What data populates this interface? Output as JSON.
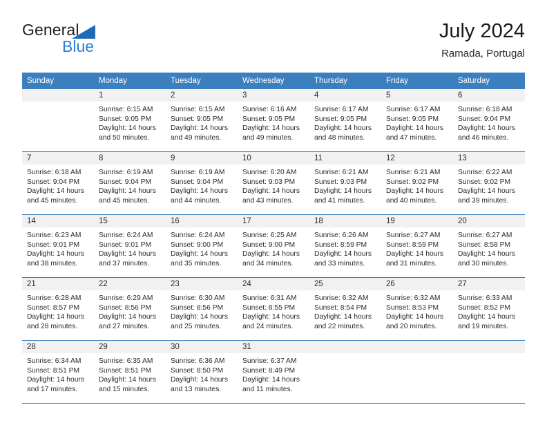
{
  "brand": {
    "name_part1": "General",
    "name_part2": "Blue",
    "accent_color": "#2a7fd4",
    "triangle_color": "#1b6cb5"
  },
  "header": {
    "month_title": "July 2024",
    "location": "Ramada, Portugal"
  },
  "calendar": {
    "header_bg": "#3c7fbf",
    "daynum_bg": "#f1f1f1",
    "weekdays": [
      "Sunday",
      "Monday",
      "Tuesday",
      "Wednesday",
      "Thursday",
      "Friday",
      "Saturday"
    ],
    "weeks": [
      [
        {
          "day": "",
          "sunrise": "",
          "sunset": "",
          "daylight_1": "",
          "daylight_2": ""
        },
        {
          "day": "1",
          "sunrise": "Sunrise: 6:15 AM",
          "sunset": "Sunset: 9:05 PM",
          "daylight_1": "Daylight: 14 hours",
          "daylight_2": "and 50 minutes."
        },
        {
          "day": "2",
          "sunrise": "Sunrise: 6:15 AM",
          "sunset": "Sunset: 9:05 PM",
          "daylight_1": "Daylight: 14 hours",
          "daylight_2": "and 49 minutes."
        },
        {
          "day": "3",
          "sunrise": "Sunrise: 6:16 AM",
          "sunset": "Sunset: 9:05 PM",
          "daylight_1": "Daylight: 14 hours",
          "daylight_2": "and 49 minutes."
        },
        {
          "day": "4",
          "sunrise": "Sunrise: 6:17 AM",
          "sunset": "Sunset: 9:05 PM",
          "daylight_1": "Daylight: 14 hours",
          "daylight_2": "and 48 minutes."
        },
        {
          "day": "5",
          "sunrise": "Sunrise: 6:17 AM",
          "sunset": "Sunset: 9:05 PM",
          "daylight_1": "Daylight: 14 hours",
          "daylight_2": "and 47 minutes."
        },
        {
          "day": "6",
          "sunrise": "Sunrise: 6:18 AM",
          "sunset": "Sunset: 9:04 PM",
          "daylight_1": "Daylight: 14 hours",
          "daylight_2": "and 46 minutes."
        }
      ],
      [
        {
          "day": "7",
          "sunrise": "Sunrise: 6:18 AM",
          "sunset": "Sunset: 9:04 PM",
          "daylight_1": "Daylight: 14 hours",
          "daylight_2": "and 45 minutes."
        },
        {
          "day": "8",
          "sunrise": "Sunrise: 6:19 AM",
          "sunset": "Sunset: 9:04 PM",
          "daylight_1": "Daylight: 14 hours",
          "daylight_2": "and 45 minutes."
        },
        {
          "day": "9",
          "sunrise": "Sunrise: 6:19 AM",
          "sunset": "Sunset: 9:04 PM",
          "daylight_1": "Daylight: 14 hours",
          "daylight_2": "and 44 minutes."
        },
        {
          "day": "10",
          "sunrise": "Sunrise: 6:20 AM",
          "sunset": "Sunset: 9:03 PM",
          "daylight_1": "Daylight: 14 hours",
          "daylight_2": "and 43 minutes."
        },
        {
          "day": "11",
          "sunrise": "Sunrise: 6:21 AM",
          "sunset": "Sunset: 9:03 PM",
          "daylight_1": "Daylight: 14 hours",
          "daylight_2": "and 41 minutes."
        },
        {
          "day": "12",
          "sunrise": "Sunrise: 6:21 AM",
          "sunset": "Sunset: 9:02 PM",
          "daylight_1": "Daylight: 14 hours",
          "daylight_2": "and 40 minutes."
        },
        {
          "day": "13",
          "sunrise": "Sunrise: 6:22 AM",
          "sunset": "Sunset: 9:02 PM",
          "daylight_1": "Daylight: 14 hours",
          "daylight_2": "and 39 minutes."
        }
      ],
      [
        {
          "day": "14",
          "sunrise": "Sunrise: 6:23 AM",
          "sunset": "Sunset: 9:01 PM",
          "daylight_1": "Daylight: 14 hours",
          "daylight_2": "and 38 minutes."
        },
        {
          "day": "15",
          "sunrise": "Sunrise: 6:24 AM",
          "sunset": "Sunset: 9:01 PM",
          "daylight_1": "Daylight: 14 hours",
          "daylight_2": "and 37 minutes."
        },
        {
          "day": "16",
          "sunrise": "Sunrise: 6:24 AM",
          "sunset": "Sunset: 9:00 PM",
          "daylight_1": "Daylight: 14 hours",
          "daylight_2": "and 35 minutes."
        },
        {
          "day": "17",
          "sunrise": "Sunrise: 6:25 AM",
          "sunset": "Sunset: 9:00 PM",
          "daylight_1": "Daylight: 14 hours",
          "daylight_2": "and 34 minutes."
        },
        {
          "day": "18",
          "sunrise": "Sunrise: 6:26 AM",
          "sunset": "Sunset: 8:59 PM",
          "daylight_1": "Daylight: 14 hours",
          "daylight_2": "and 33 minutes."
        },
        {
          "day": "19",
          "sunrise": "Sunrise: 6:27 AM",
          "sunset": "Sunset: 8:59 PM",
          "daylight_1": "Daylight: 14 hours",
          "daylight_2": "and 31 minutes."
        },
        {
          "day": "20",
          "sunrise": "Sunrise: 6:27 AM",
          "sunset": "Sunset: 8:58 PM",
          "daylight_1": "Daylight: 14 hours",
          "daylight_2": "and 30 minutes."
        }
      ],
      [
        {
          "day": "21",
          "sunrise": "Sunrise: 6:28 AM",
          "sunset": "Sunset: 8:57 PM",
          "daylight_1": "Daylight: 14 hours",
          "daylight_2": "and 28 minutes."
        },
        {
          "day": "22",
          "sunrise": "Sunrise: 6:29 AM",
          "sunset": "Sunset: 8:56 PM",
          "daylight_1": "Daylight: 14 hours",
          "daylight_2": "and 27 minutes."
        },
        {
          "day": "23",
          "sunrise": "Sunrise: 6:30 AM",
          "sunset": "Sunset: 8:56 PM",
          "daylight_1": "Daylight: 14 hours",
          "daylight_2": "and 25 minutes."
        },
        {
          "day": "24",
          "sunrise": "Sunrise: 6:31 AM",
          "sunset": "Sunset: 8:55 PM",
          "daylight_1": "Daylight: 14 hours",
          "daylight_2": "and 24 minutes."
        },
        {
          "day": "25",
          "sunrise": "Sunrise: 6:32 AM",
          "sunset": "Sunset: 8:54 PM",
          "daylight_1": "Daylight: 14 hours",
          "daylight_2": "and 22 minutes."
        },
        {
          "day": "26",
          "sunrise": "Sunrise: 6:32 AM",
          "sunset": "Sunset: 8:53 PM",
          "daylight_1": "Daylight: 14 hours",
          "daylight_2": "and 20 minutes."
        },
        {
          "day": "27",
          "sunrise": "Sunrise: 6:33 AM",
          "sunset": "Sunset: 8:52 PM",
          "daylight_1": "Daylight: 14 hours",
          "daylight_2": "and 19 minutes."
        }
      ],
      [
        {
          "day": "28",
          "sunrise": "Sunrise: 6:34 AM",
          "sunset": "Sunset: 8:51 PM",
          "daylight_1": "Daylight: 14 hours",
          "daylight_2": "and 17 minutes."
        },
        {
          "day": "29",
          "sunrise": "Sunrise: 6:35 AM",
          "sunset": "Sunset: 8:51 PM",
          "daylight_1": "Daylight: 14 hours",
          "daylight_2": "and 15 minutes."
        },
        {
          "day": "30",
          "sunrise": "Sunrise: 6:36 AM",
          "sunset": "Sunset: 8:50 PM",
          "daylight_1": "Daylight: 14 hours",
          "daylight_2": "and 13 minutes."
        },
        {
          "day": "31",
          "sunrise": "Sunrise: 6:37 AM",
          "sunset": "Sunset: 8:49 PM",
          "daylight_1": "Daylight: 14 hours",
          "daylight_2": "and 11 minutes."
        },
        {
          "day": "",
          "sunrise": "",
          "sunset": "",
          "daylight_1": "",
          "daylight_2": ""
        },
        {
          "day": "",
          "sunrise": "",
          "sunset": "",
          "daylight_1": "",
          "daylight_2": ""
        },
        {
          "day": "",
          "sunrise": "",
          "sunset": "",
          "daylight_1": "",
          "daylight_2": ""
        }
      ]
    ]
  }
}
